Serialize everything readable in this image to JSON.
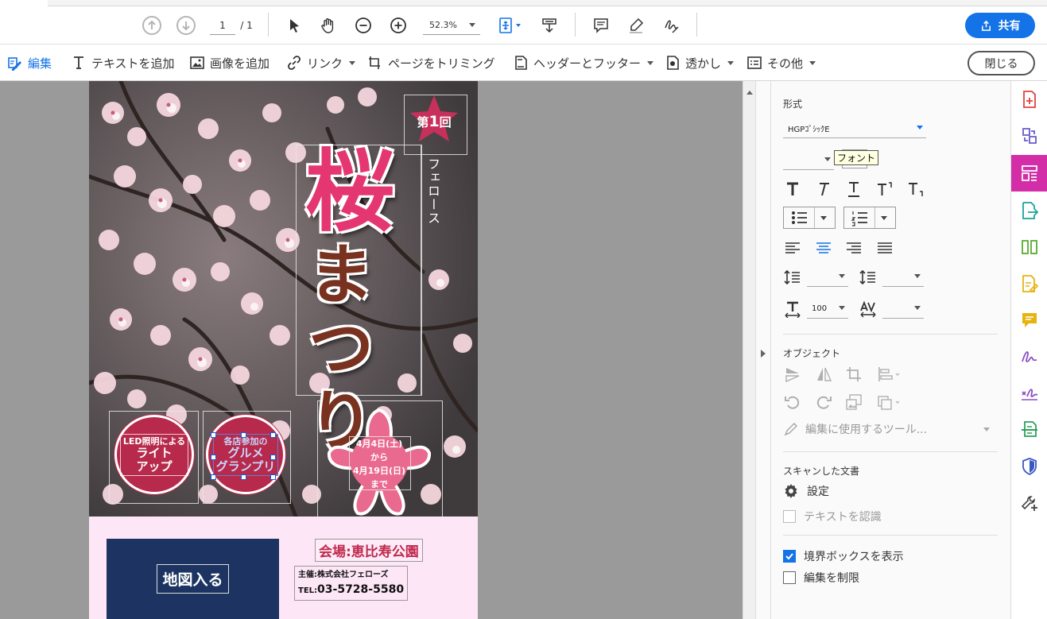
{
  "top_toolbar": {
    "page_current": "1",
    "page_total": "/ 1",
    "zoom": "52.3%",
    "share_label": "共有"
  },
  "edit_toolbar": {
    "edit": "編集",
    "add_text": "テキストを追加",
    "add_image": "画像を追加",
    "link": "リンク",
    "crop_pages": "ページをトリミング",
    "header_footer": "ヘッダーとフッター",
    "watermark": "透かし",
    "more": "その他",
    "close": "閉じる"
  },
  "document": {
    "badge_prefix": "第",
    "badge_number": "1",
    "badge_suffix": "回",
    "company_vertical": "フェロース",
    "title_main": "桜",
    "title_sub_1": "ま",
    "title_sub_2": "つ",
    "title_sub_3": "り",
    "disc1_small": "LED照明による",
    "disc1_big_1": "ライト",
    "disc1_big_2": "アップ",
    "disc2_small": "各店参加の",
    "disc2_big_1": "グルメ",
    "disc2_big_2": "グランプリ",
    "date_line1": "4月4日(土)",
    "date_line2": "から",
    "date_line3": "4月19日(日)",
    "date_line4": "まで",
    "map_label": "地図入る",
    "venue": "会場:恵比寿公園",
    "organizer": "主催:株式会社フェローズ",
    "tel_prefix": "TEL:",
    "tel": "03-5728-5580"
  },
  "panel": {
    "format_title": "形式",
    "font_name": "HGPｺﾞｼｯｸE",
    "tooltip": "フォント",
    "scale_value": "100",
    "object_title": "オブジェクト",
    "edit_tool_label": "編集に使用するツール...",
    "scanned_title": "スキャンした文書",
    "settings_label": "設定",
    "recognize_text_label": "テキストを認識",
    "show_bbox_label": "境界ボックスを表示",
    "restrict_edit_label": "編集を制限",
    "show_bbox_checked": true,
    "restrict_edit_checked": false
  },
  "colors": {
    "accent": "#1473e6",
    "rail_active": "#d32ea7",
    "poster_pink": "#e43670",
    "poster_bg": "#fde6f6",
    "map_navy": "#1d3462"
  }
}
